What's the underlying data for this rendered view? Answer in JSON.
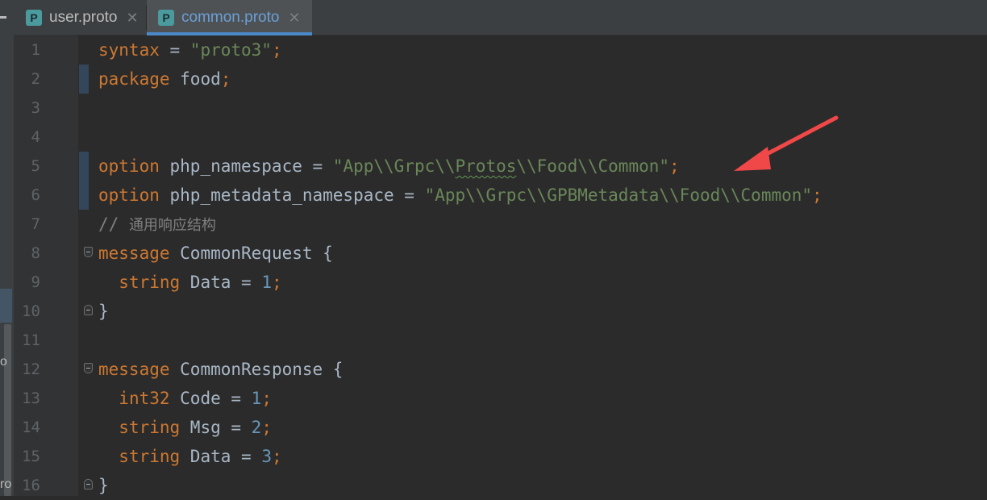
{
  "tabs": [
    {
      "icon": "P",
      "label": "user.proto",
      "close": "✕",
      "active": false
    },
    {
      "icon": "P",
      "label": "common.proto",
      "close": "✕",
      "active": true
    }
  ],
  "left_panel_glyphs": [
    "o",
    "ro"
  ],
  "line_numbers": [
    "1",
    "2",
    "3",
    "4",
    "5",
    "6",
    "7",
    "8",
    "9",
    "10",
    "11",
    "12",
    "13",
    "14",
    "15",
    "16"
  ],
  "code": {
    "l1": {
      "kw": "syntax",
      "eq": " = ",
      "str": "\"proto3\"",
      "semi": ";"
    },
    "l2": {
      "kw": "package",
      "rest": " food",
      "semi": ";"
    },
    "l5": {
      "kw": "option",
      "rest": " php_namespace = ",
      "s1": "\"App\\\\Grpc\\\\",
      "s2": "Protos",
      "s3": "\\\\Food\\\\Common\"",
      "semi": ";"
    },
    "l6": {
      "kw": "option",
      "rest": " php_metadata_namespace = ",
      "str": "\"App\\\\Grpc\\\\GPBMetadata\\\\Food\\\\Common\"",
      "semi": ";"
    },
    "l7": {
      "slashes": "// ",
      "text": "通用响应结构"
    },
    "l8": {
      "kw": "message",
      "rest": " CommonRequest {"
    },
    "l9": {
      "indent": "  ",
      "kw": "string",
      "rest": " Data = ",
      "num": "1",
      "semi": ";"
    },
    "l10": {
      "rest": "}"
    },
    "l12": {
      "kw": "message",
      "rest": " CommonResponse {"
    },
    "l13": {
      "indent": "  ",
      "kw": "int32",
      "rest": " Code = ",
      "num": "1",
      "semi": ";"
    },
    "l14": {
      "indent": "  ",
      "kw": "string",
      "rest": " Msg = ",
      "num": "2",
      "semi": ";"
    },
    "l15": {
      "indent": "  ",
      "kw": "string",
      "rest": " Data = ",
      "num": "3",
      "semi": ";"
    },
    "l16": {
      "rest": "}"
    }
  },
  "colors": {
    "background": "#2b2b2b",
    "keyword": "#cc7832",
    "string": "#6a8759",
    "number": "#6897bb",
    "identifier": "#a9b7c6",
    "comment": "#808080",
    "active_tab_text": "#6b9fd6",
    "file_icon": "#4a9a9e",
    "annotation_arrow": "#f04848"
  },
  "icons": [
    "proto-file-icon",
    "close-icon",
    "fold-marker-icon",
    "annotation-arrow"
  ]
}
